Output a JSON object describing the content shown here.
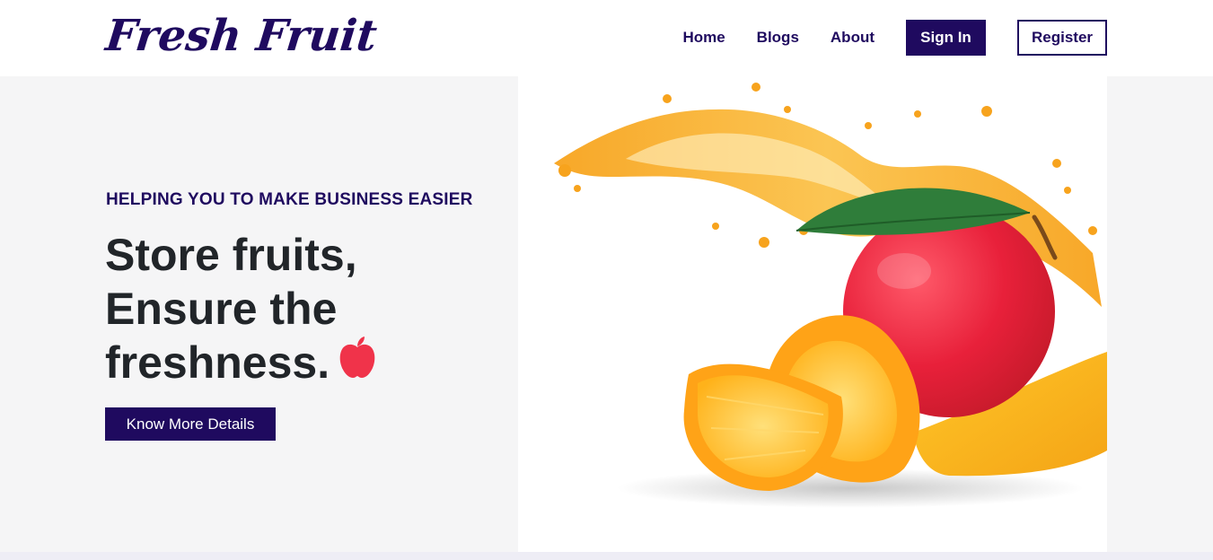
{
  "brand": {
    "logo_text": "Fresh Fruit"
  },
  "nav": {
    "items": [
      {
        "label": "Home"
      },
      {
        "label": "Blogs"
      },
      {
        "label": "About"
      }
    ],
    "signin_label": "Sign In",
    "register_label": "Register"
  },
  "hero": {
    "eyebrow": "HELPING YOU TO MAKE BUSINESS EASIER",
    "headline_line1": "Store fruits,",
    "headline_line2": "Ensure the",
    "headline_line3": "freshness.",
    "headline_icon": "apple-icon",
    "cta_label": "Know More Details",
    "image": "fruit-splash-illustration"
  },
  "colors": {
    "brand": "#1f0a5f",
    "hero_bg": "#f5f5f6",
    "text_dark": "#212529",
    "apple_red": "#f0334a"
  }
}
